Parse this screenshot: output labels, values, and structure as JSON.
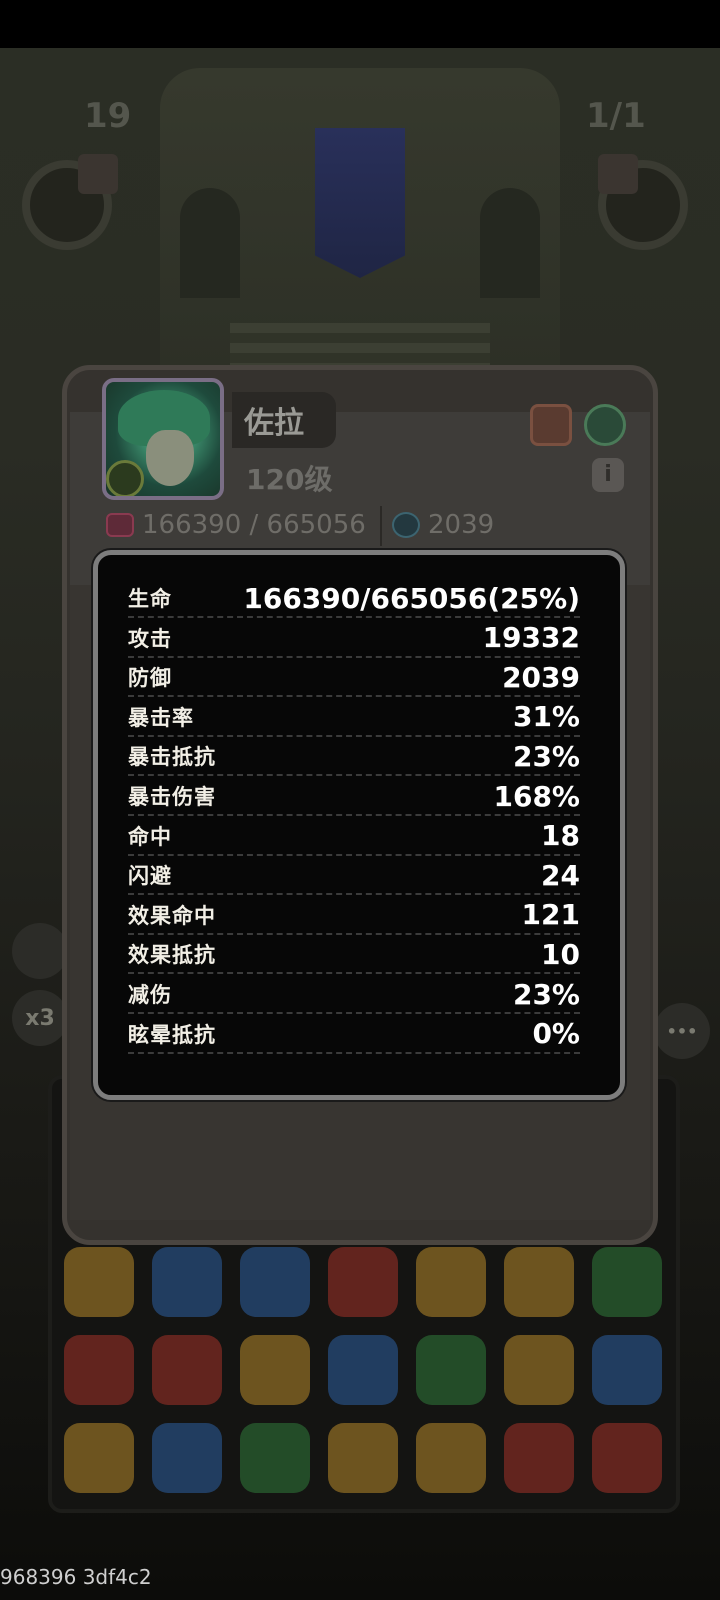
{
  "hud": {
    "left_counter": "19",
    "right_counter": "1/1"
  },
  "character": {
    "name": "佐拉",
    "level": "120级",
    "hp_text": "166390 / 665056",
    "defense_text": "2039",
    "info_label": "i"
  },
  "stats": [
    {
      "label": "生命",
      "value": "166390/665056(25%)"
    },
    {
      "label": "攻击",
      "value": "19332"
    },
    {
      "label": "防御",
      "value": "2039"
    },
    {
      "label": "暴击率",
      "value": "31%"
    },
    {
      "label": "暴击抵抗",
      "value": "23%"
    },
    {
      "label": "暴击伤害",
      "value": "168%"
    },
    {
      "label": "命中",
      "value": "18"
    },
    {
      "label": "闪避",
      "value": "24"
    },
    {
      "label": "效果命中",
      "value": "121"
    },
    {
      "label": "效果抵抗",
      "value": "10"
    },
    {
      "label": "减伤",
      "value": "23%"
    },
    {
      "label": "眩晕抵抗",
      "value": "0%"
    }
  ],
  "side_buttons": {
    "speed": "x3",
    "more": "•••"
  },
  "watermark": "968396 3df4c2",
  "colors": {
    "tooltip_bg": "#070707",
    "tooltip_border": "#7d7d7d",
    "card_bg": "#35322e"
  }
}
